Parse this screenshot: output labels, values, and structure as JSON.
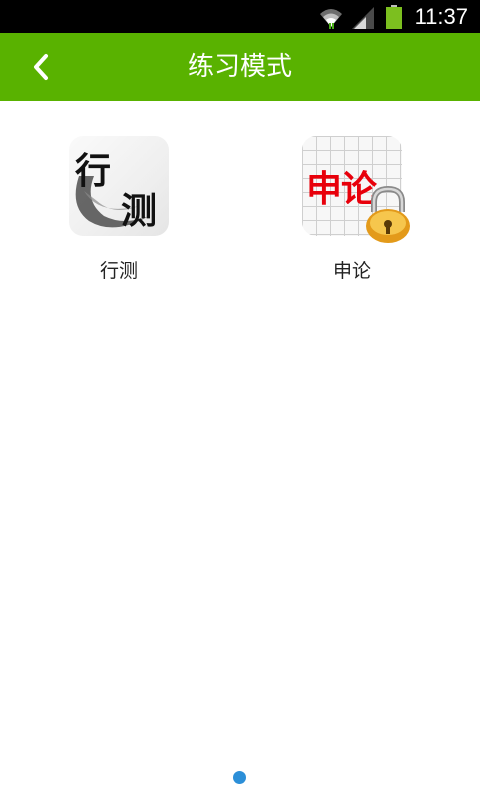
{
  "status_bar": {
    "time": "11:37"
  },
  "header": {
    "title": "练习模式"
  },
  "items": [
    {
      "label": "行测",
      "icon_text_1": "行",
      "icon_text_2": "测",
      "locked": false
    },
    {
      "label": "申论",
      "icon_text": "申论",
      "locked": true
    }
  ],
  "colors": {
    "accent": "#59b200",
    "lock_text": "#e8000b",
    "pager_dot": "#2c8fd8"
  },
  "pager": {
    "current_page": 1
  }
}
